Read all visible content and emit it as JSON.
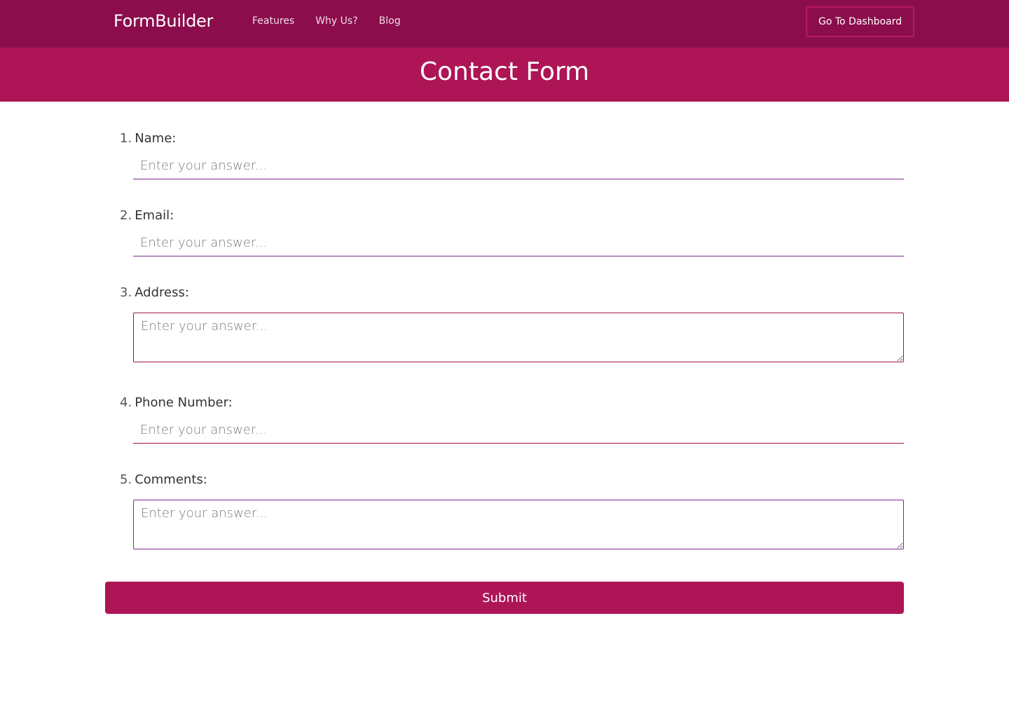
{
  "navbar": {
    "brand": "FormBuilder",
    "links": [
      "Features",
      "Why Us?",
      "Blog"
    ],
    "dashboard_label": "Go To Dashboard"
  },
  "header": {
    "title": "Contact Form"
  },
  "form": {
    "questions": [
      {
        "number": "1.",
        "label": "Name:",
        "placeholder": "Enter your answer...",
        "type": "text"
      },
      {
        "number": "2.",
        "label": "Email:",
        "placeholder": "Enter your answer...",
        "type": "text"
      },
      {
        "number": "3.",
        "label": "Address:",
        "placeholder": "Enter your answer...",
        "type": "textarea"
      },
      {
        "number": "4.",
        "label": "Phone Number:",
        "placeholder": "Enter your answer...",
        "type": "text"
      },
      {
        "number": "5.",
        "label": "Comments:",
        "placeholder": "Enter your answer...",
        "type": "textarea"
      }
    ],
    "submit_label": "Submit"
  },
  "colors": {
    "navbar_bg": "#8b0d4c",
    "accent": "#ad1556",
    "input_purple": "#7b2a8a",
    "input_crimson": "#a0144e"
  }
}
